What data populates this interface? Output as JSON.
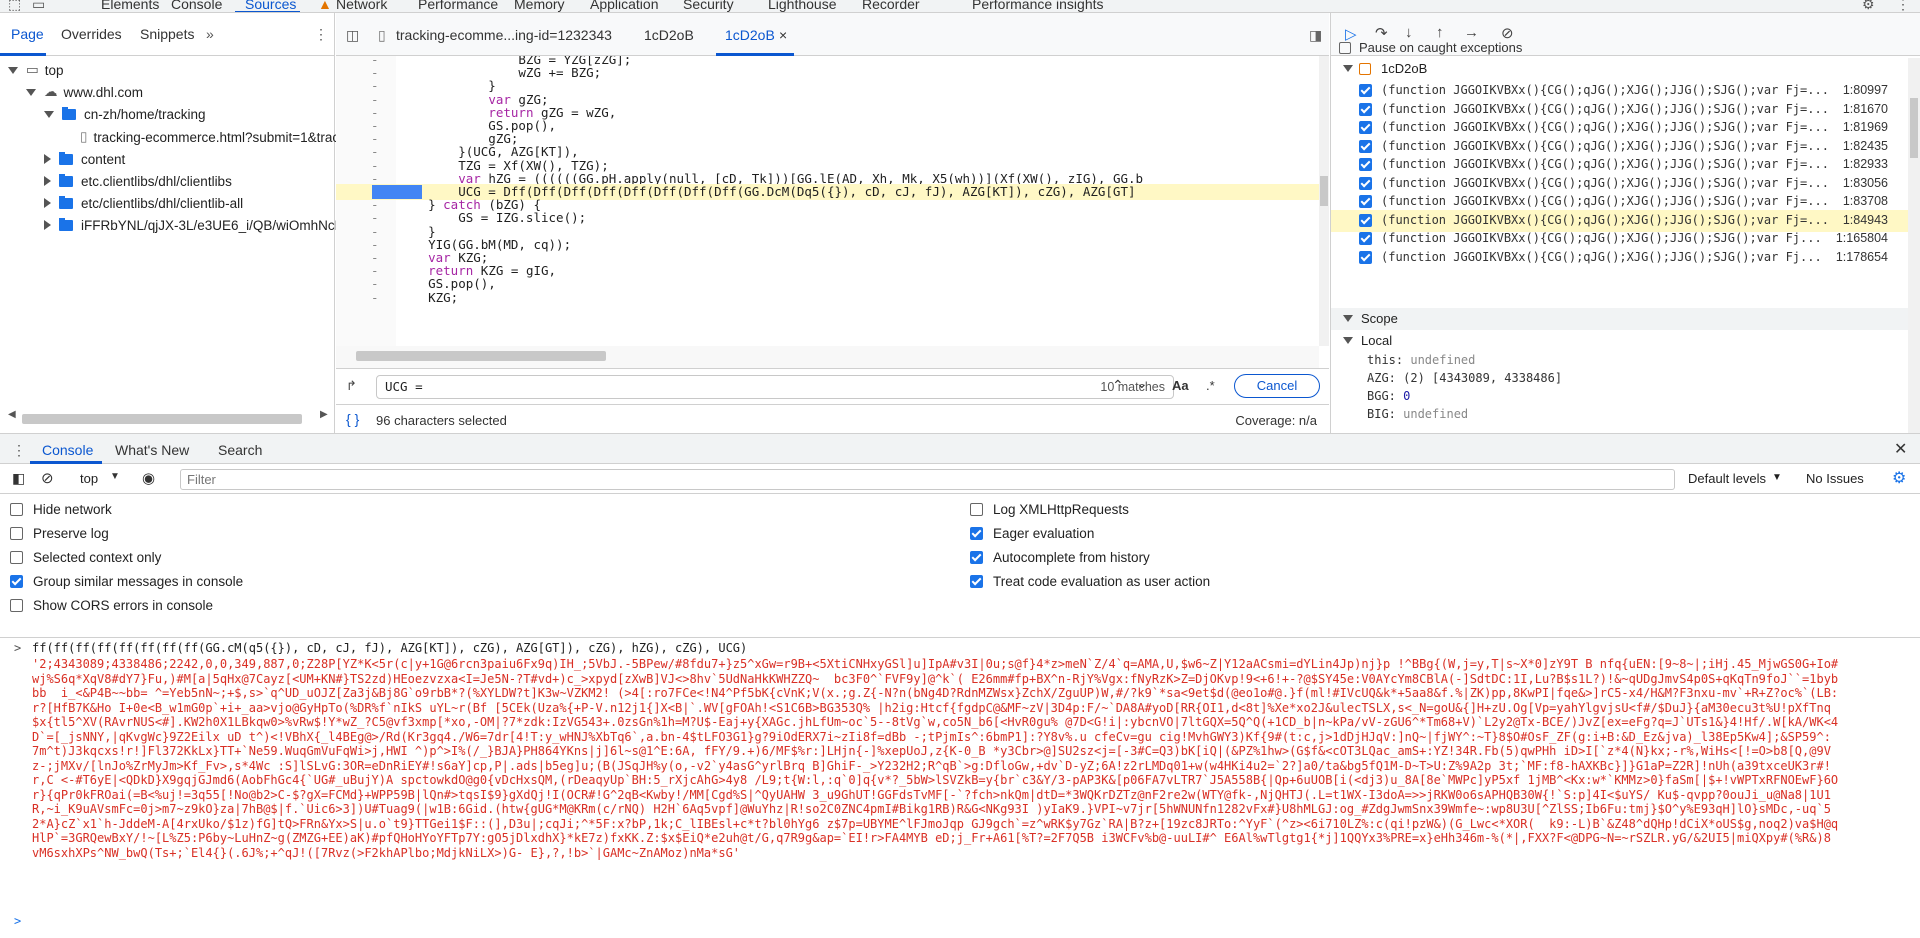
{
  "topbar": {
    "tabs": [
      "Elements",
      "Console",
      "Sources",
      "Network",
      "Performance",
      "Memory",
      "Application",
      "Security",
      "Lighthouse",
      "Recorder",
      "Performance insights"
    ],
    "active": "Sources"
  },
  "navigator": {
    "tabs": [
      "Page",
      "Overrides",
      "Snippets"
    ],
    "tree": [
      {
        "label": "top",
        "depth": 0,
        "open": true,
        "kind": "frame"
      },
      {
        "label": "www.dhl.com",
        "depth": 1,
        "open": true,
        "kind": "cloud"
      },
      {
        "label": "cn-zh/home/tracking",
        "depth": 2,
        "open": true,
        "kind": "folder"
      },
      {
        "label": "tracking-ecommerce.html?submit=1&trac",
        "depth": 3,
        "kind": "file"
      },
      {
        "label": "content",
        "depth": 2,
        "open": false,
        "kind": "folder"
      },
      {
        "label": "etc.clientlibs/dhl/clientlibs",
        "depth": 2,
        "open": false,
        "kind": "folder"
      },
      {
        "label": "etc/clientlibs/dhl/clientlib-all",
        "depth": 2,
        "open": false,
        "kind": "folder"
      },
      {
        "label": "iFFRbYNL/qjJX-3L/e3UE6_i/QB/wiOmhNcDp",
        "depth": 2,
        "open": false,
        "kind": "folder"
      }
    ]
  },
  "editor": {
    "tabs": [
      "tracking-ecomme...ing-id=1232343",
      "1cD2oB",
      "1cD2oB"
    ],
    "lines": [
      "                BZG = YZG[zZG];",
      "                wZG += BZG;",
      "            }",
      "            var gZG;",
      "            return gZG = wZG,",
      "            GS.pop(),",
      "            gZG;",
      "        }(UCG, AZG[KT]),",
      "        TZG = Xf(XW(), TZG);",
      "        var hZG = ((((((GG.pH.apply(null, [cD, Tk]))[GG.lE(AD, Xh, Mk, X5(wh))](Xf(XW(), zIG), GG.b",
      "        UCG = Dff(Dff(Dff(Dff(Dff(Dff(Dff(Dff(GG.DcM(Dq5({}), cD, cJ, fJ), AZG[KT]), cZG), AZG[GT]",
      "    } catch (bZG) {",
      "        GS = IZG.slice();",
      "    }",
      "    YIG(GG.bM(MD, cq));",
      "    var KZG;",
      "    return KZG = gIG,",
      "    GS.pop(),",
      "    KZG;"
    ],
    "search": {
      "query": "UCG =",
      "matches": "10 matches",
      "case_label": "Aa",
      "regex_label": ".*",
      "cancel": "Cancel"
    },
    "status": {
      "selected": "96 characters selected",
      "coverage": "Coverage: n/a"
    }
  },
  "debugger": {
    "pause_caught": "Pause on caught exceptions",
    "callstack_title": "1cD2oB",
    "frames": [
      {
        "fn": "(function JGGOIKVBXx(){CG();qJG();XJG();JJG();SJG();var Fj=...",
        "loc": "1:80997"
      },
      {
        "fn": "(function JGGOIKVBXx(){CG();qJG();XJG();JJG();SJG();var Fj=...",
        "loc": "1:81670"
      },
      {
        "fn": "(function JGGOIKVBXx(){CG();qJG();XJG();JJG();SJG();var Fj=...",
        "loc": "1:81969"
      },
      {
        "fn": "(function JGGOIKVBXx(){CG();qJG();XJG();JJG();SJG();var Fj=...",
        "loc": "1:82435"
      },
      {
        "fn": "(function JGGOIKVBXx(){CG();qJG();XJG();JJG();SJG();var Fj=...",
        "loc": "1:82933"
      },
      {
        "fn": "(function JGGOIKVBXx(){CG();qJG();XJG();JJG();SJG();var Fj=...",
        "loc": "1:83056"
      },
      {
        "fn": "(function JGGOIKVBXx(){CG();qJG();XJG();JJG();SJG();var Fj=...",
        "loc": "1:83708"
      },
      {
        "fn": "(function JGGOIKVBXx(){CG();qJG();XJG();JJG();SJG();var Fj=...",
        "loc": "1:84943"
      },
      {
        "fn": "(function JGGOIKVBXx(){CG();qJG();XJG();JJG();SJG();var Fj...",
        "loc": "1:165804"
      },
      {
        "fn": "(function JGGOIKVBXx(){CG();qJG();XJG();JJG();SJG();var Fj...",
        "loc": "1:178654"
      }
    ],
    "scope_title": "Scope",
    "local_title": "Local",
    "vars": [
      {
        "name": "this:",
        "value": "undefined"
      },
      {
        "name": "AZG:",
        "value": "(2) [4343089, 4338486]"
      },
      {
        "name": "BGG:",
        "value": "0"
      },
      {
        "name": "BIG:",
        "value": "undefined"
      }
    ]
  },
  "drawer": {
    "tabs": [
      "Console",
      "What's New",
      "Search"
    ],
    "context": "top",
    "filter_placeholder": "Filter",
    "levels": "Default levels",
    "issues": "No Issues",
    "options_left": [
      {
        "label": "Hide network",
        "checked": false
      },
      {
        "label": "Preserve log",
        "checked": false
      },
      {
        "label": "Selected context only",
        "checked": false
      },
      {
        "label": "Group similar messages in console",
        "checked": true
      },
      {
        "label": "Show CORS errors in console",
        "checked": false
      }
    ],
    "options_right": [
      {
        "label": "Log XMLHttpRequests",
        "checked": false
      },
      {
        "label": "Eager evaluation",
        "checked": true
      },
      {
        "label": "Autocomplete from history",
        "checked": true
      },
      {
        "label": "Treat code evaluation as user action",
        "checked": true
      }
    ],
    "input_line": "ff(ff(ff(ff(ff(ff(ff(ff(GG.cM(q5({}), cD, cJ, fJ), AZG[KT]), cZG), AZG[GT]), cZG), hZG), cZG), UCG)",
    "output_lines": [
      "'2;4343089;4338486;2242,0,0,349,887,0;Z28P[YZ*K<5r(c|y+1G@6rcn3paiu6Fx9q)IH_;5VbJ.-5BPew/#8fdu7+}z5^xGw=r9B+<5XtiCNHxyGSl]u]IpA#v3I|0u;s@f}4*z>meN`Z/4`q=AMA,U,$w6~Z|Y12aACsmi=dYLin4Jp)nj}p !^BBg{(W,j=y,T|s~X*0]zY9T B nfq{uEN:[9~8~|;iHj.45_MjwGS0G+Io#",
      "wj%S6q*XqV8#dY7}Fu,)#M[a|5qHx@7Cayz[<UM+KN#}TS2zd)HEoezvzxa<I=Je5N-?T#vd+)c_>xpyd[zXwB]VJ<>8hv`5UdNaHkKWHZZQ~  bc3F0^`FVF9y]@^k`( E26mm#fp+BX^n-RjY%Vgx:fNyRzK>Z=DjOKvp!9<+6!+-?@$SY45e:V0AYcYm8CBlA(-]SdtDC:1I,Lu?B$s1L?)!&~qUDgJmvS4p0S+qKqTn9foJ``=1byb",
      "bb  i_<&P4B~~bb= ^=Yeb5nN~;+$,s>`q^UD_uOJZ[Za3j&Bj8G`o9rbB*?(%XYLDW?t]K3w~VZKM2! (>4[:ro7FCe<!N4^Pf5bK{cVnK;V(x.;g.Z{-N?n(bNg4D?RdnMZWsx}ZchX/ZguUP)W,#/?k9`*sa<9et$d(@eo1o#@.}f(ml!#IVcUQ&k*+5aa8&f.%|ZK)pp,8KwPI|fqe&>]rC5-x4/H&M?F3nxu-mv`+R+Z?oc%`(LB:",
      "r?[HfB7K&Ho I+0e<B_w1mG0p`+i+_aa>vjo@GyHpTo(%DR%f`nIkS uYL~r(Bf [5CEk(Uza%{+P-V.n12j1{]X<B|`.WV[gFOAh!<S1C6B>BG353Q% |h2ig:Htcf{fgdpC@&MF~zV|3D4p:F/~`DA8A#yoD[RR{OI1,d<8t]%Xe*xo2J&ulecTSLX,s<_N=goU&{]H+zU.Og[Vp=yahYlgvjsU<f#/$DuJ}{aM30ecu3t%U!pXfTnq",
      "$x{tl5^XV(RAvrNUS<#].KW2h0X1LBkqw0>%vRw$!Y*wZ_?C5@vf3xmp[*xo,-OM|?7*zdk:IzVG543+.0zsGn%1h=M?U$-Eaj+y{XAGc.jhLfUm~oc`5--8tVg`w,co5N_b6[<HvR0gu% @7D<G!i|:ybcnVO|7ltGQX=5Q^Q(+1CD_b|n~kPa/vV-zGU6^*Tm68+V)`L2y2@Tx-BCE/)JvZ[ex=eFg?q=J`UTs1&}4!Hf/.W[kA/WK<4",
      "D`=[_jsNNY,|qKvgWc}9Z2Eilx uD t^)<!VBhX{_l4BEg@>/Rd(Kr3gq4./W6=7dr[4!T:y_wHNJ%XbTq6`,a.bn-4$tLFO3G1}g?9iOdERX7i~zIi8f=dBb -;tPjmIs^:6bmP1]:?Y8v%.u cfeCv=gu cig!MvhGWY3)Kf{9#(t:c,j>1dDjHJqV:]nQ~|fjWY^:~T}8$O#OsF_ZF(g:i+B:&D_Ez&jva)_l38Ep5Kw4];&SP59^:",
      "7m^t)J3kqcxs!r!]Fl372KkLx}TT+`Ne59.WuqGmVuFqWi>j,HWI ^)p^>I%(/_}BJA}PH864YKns|j]6l~s@1^E:6A, fFY/9.+)6/MF$%r:]LHjn{-]%xepUoJ,z{K-0_B *y3Cbr>@]SU2sz<j=[-3#C=Q3)bK[iQ|(&PZ%1hw>(G$f&<cOT3LQac_amS+:YZ!34R.Fb(5)qwPHh iD>I[`z*4(N}kx;-r%,WiHs<[!=O>b8[Q,@9V",
      "z-;jMXv/[lnJo%ZrMyJm>Kf_Fv>,s*4Wc :S]lSLvG:3OR=eDnRiEY#!s6aY]cp,P|.ads|b5eg]u;(B(JSqJH%y(o,-v2`y4asG^yrlBrq B]GhiF-_>Y232H2;R^qB`>g:DfloGw,+dv`D-yZ;6A!z2rLMDq01+w(w4HKi4u2=`2?]a0/ta&bg5fQ1M-D~T>U:Z%9A2p 3t;`MF:f8-hAXKBc}]}G1aP=Z2R]!nUh(a39txceUK3r#!",
      "r,C <-#T6yE|<QDkD}X9gqjGJmd6(AobFhGc4{`UG#_uBujY)A spctowkdO@g0{vDcHxsQM,(rDeaqyUp`BH:5_rXjcAhG>4y8 /L9;t{W:l,:q`0]q{v*?_5bW>lSVZkB=y{br`c3&Y/3-pAP3K&[p06FA7vLTR7`J5A558B{|Qp+6uUOB[i(<dj3)u_8A[8e`MWPc]yP5xf 1jMB^<Kx:w*`KMMz>0}faSm[|$+!vWPTxRFNOEwF}6O",
      "r}{qPr0kFROai(=B<%uj!=3q55[!No@b2>C-$?gX=FCMd}+WPP59B|lQn#>tqsI$9}gXdQj!I(OCR#!G^2qB<Kwby!/MM[Cgd%S|^QyUAHW 3_u9GhUT!GGFdsTvMF[-`?fch>nkQm|dtD=*3WQKrDZTz@nF2re2w(WTY@fk-,NjQHTJ(.L=t1WX-I3doA=>>jRKW0o6sAPHQB30W{!`S:p]4I<$uYS/ Ku$-qvpp?0ouJi_u@Na8|1U1",
      "R,~i_K9uAVsmFc=0j>m7~z9kO}za|7hB@$|f.`Uic6>3])U#Tuag9(|w1B:6Gid.(htw{gUG*M@KRm(c/rNQ) H2H`6Aq5vpf]@WuYhz|R!so2C0ZNC4pmI#Bikg1RB)R&G<NKg93I )yIaK9.}VPI~v7jr[5hWNUNfn1282vFx#}U8hMLGJ:og_#ZdgJwmSnx39Wmfe~:wp8U3U[^ZlSS;Ib6Fu:tmj}$O^y%E93qH]lO}sMDc,-uq`5",
      "2*A}cZ`x1`h-JddeM-A[4rxUko/$1z)fG]tQ>FRn&Yx>S|u.o`t9}TTGei1$F::(],D3u|;cqJi;^*5F:x?bP,1k;C_lIBEsl+c*t?bl0hYg6 z$7p=UBYME^lFJmoJqp GJ9gch`=z^wRK$y7Gz`RA|B?z+[19zc8JRTo:^YyF`(^z><6i710LZ%:c(qi!pzW&)(G_Lwc<*XOR(  k9:-L)B`&Z48^dQHp!dCiX*oUS$g,noq2)va$H@q",
      "HlP`=3GRQewBxY/!~[L%Z5:P6by~LuHnZ~g(ZMZG+EE)aK)#pfQHoHYoYFTp7Y:gO5jDlxdhX}*kE7z)fxKK.Z:$x$EiQ*e2uh@t/G,q7R9g&ap=`EI!r>FA4MYB eD;j_Fr+A61[%T?=2F7Q5B i3WCFv%b@-uuLI#^ E6Al%wTlgtg1{*j]1QQYx3%PRE=x}eHh346m-%(*|,FXX?F<@DPG~N=~rSZLR.yG/&2UI5|miQXpy#(%R&)8",
      "vM6sxhXPs^NW_bwQ(Ts+;`El4{}(.6J%;+^qJ!([7Rvz(>F2khAPlbo;MdjkNiLX>)G- E},?,!b>`|GAMc~ZnAMoz)nMa*sG'"
    ]
  }
}
